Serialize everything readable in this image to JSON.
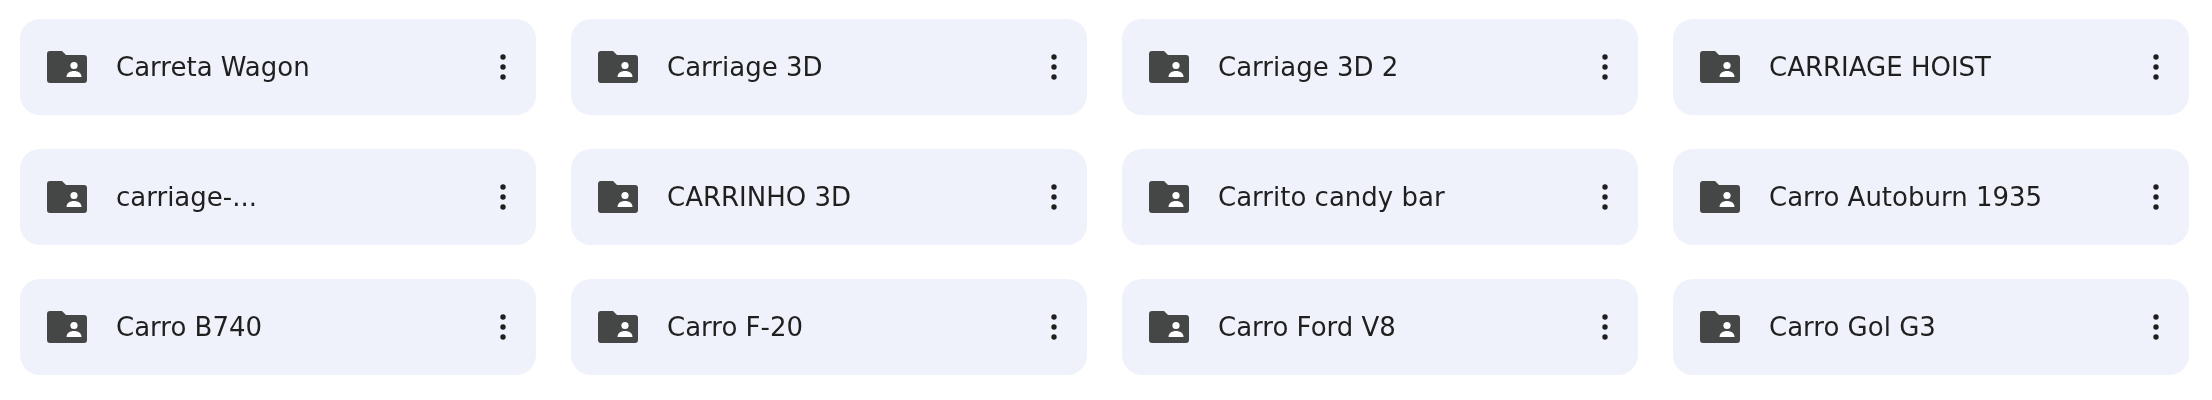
{
  "folders": [
    {
      "name": "Carreta Wagon"
    },
    {
      "name": "Carriage 3D"
    },
    {
      "name": "Carriage 3D 2"
    },
    {
      "name": "CARRIAGE HOIST"
    },
    {
      "name": "carriage-..."
    },
    {
      "name": "CARRINHO 3D"
    },
    {
      "name": "Carrito candy bar"
    },
    {
      "name": "Carro Autoburn 1935"
    },
    {
      "name": "Carro B740"
    },
    {
      "name": "Carro F-20"
    },
    {
      "name": "Carro Ford V8"
    },
    {
      "name": "Carro Gol G3"
    }
  ]
}
